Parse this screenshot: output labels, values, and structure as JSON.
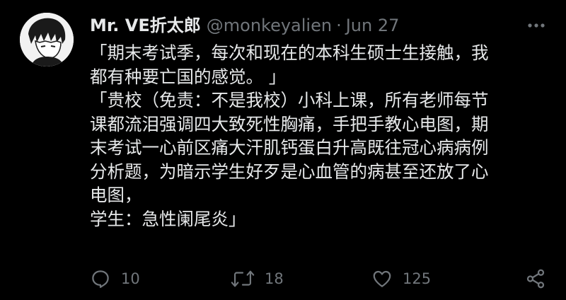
{
  "user": {
    "display_name": "Mr. VE折太郎",
    "handle": "@monkeyalien",
    "separator": "·",
    "date": "Jun 27"
  },
  "tweet": {
    "lines": [
      "「期末考试季，每次和现在的本科生硕士生接触，我",
      "都有种要亡国的感觉。 」",
      "「贵校（免责：不是我校）小科上课，所有老师每节",
      "课都流泪强调四大致死性胸痛，手把手教心电图，期",
      "末考试一心前区痛大汗肌钙蛋白升高既往冠心病病例",
      "分析题，为暗示学生好歹是心血管的病甚至还放了心",
      "电图，",
      "学生：急性阑尾炎」"
    ]
  },
  "actions": {
    "reply_count": "10",
    "retweet_count": "18",
    "like_count": "125"
  },
  "icons": {
    "avatar": "avatar-illustration",
    "more": "more-dots-icon",
    "reply": "reply-icon",
    "retweet": "retweet-icon",
    "like": "heart-icon",
    "share": "share-icon"
  },
  "colors": {
    "background": "#000000",
    "text_primary": "#e7e9ea",
    "text_secondary": "#71767b"
  }
}
